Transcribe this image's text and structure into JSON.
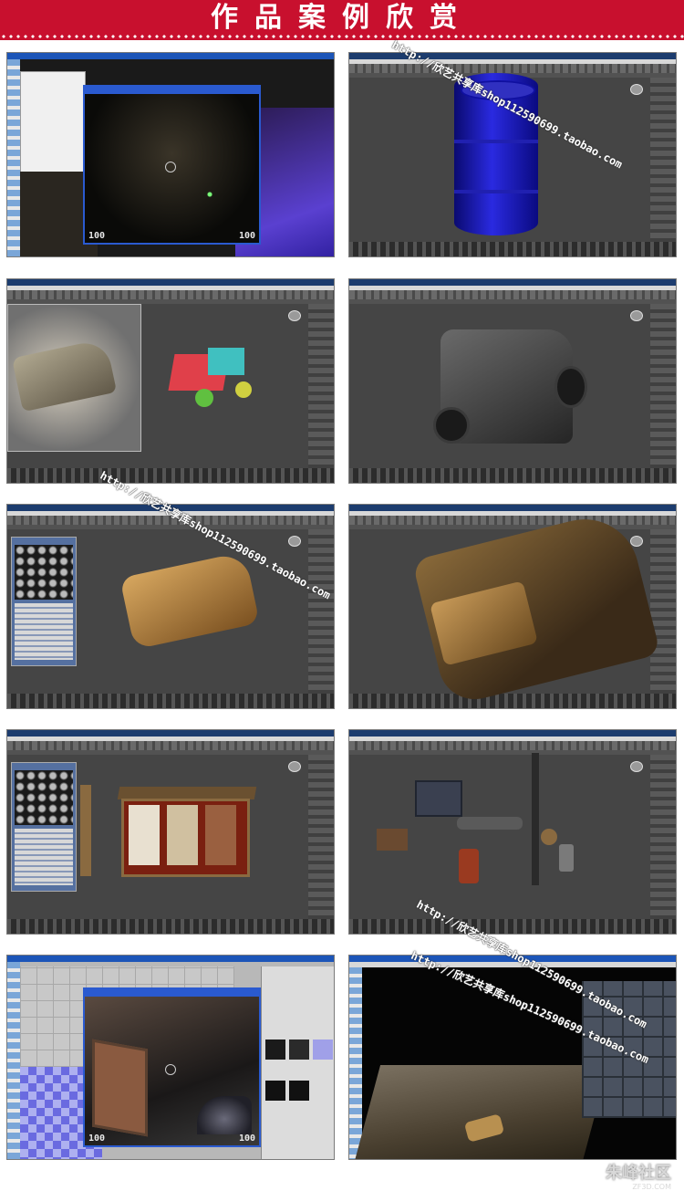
{
  "banner": {
    "title": "作品案例欣赏",
    "background": "#c8102e",
    "text_color": "#ffffff"
  },
  "screenshots": [
    {
      "label": "Unreal editor game preview with 3ds Max window",
      "hud_left": "100",
      "hud_right": "100"
    },
    {
      "label": "3ds Max oil barrel model"
    },
    {
      "label": "3ds Max jeep block-out with reference"
    },
    {
      "label": "3ds Max jeep high-poly model"
    },
    {
      "label": "3ds Max textured jeep with material editor"
    },
    {
      "label": "3ds Max textured jeep close-up"
    },
    {
      "label": "3ds Max bus shelter model with material editor"
    },
    {
      "label": "3ds Max props set"
    },
    {
      "label": "Unreal editor game preview bus shelter",
      "hud_left": "100",
      "hud_right": "100"
    },
    {
      "label": "3ds Max assembled scene"
    }
  ],
  "watermarks": [
    {
      "text": "http://欣艺共享库shop112590699.taobao.com"
    },
    {
      "text": "http://欣艺共享库shop112590699.taobao.com"
    },
    {
      "text": "http://欣艺共享库shop112590699.taobao.com"
    },
    {
      "text": "http://欣艺共享库shop112590699.taobao.com"
    }
  ],
  "site_logo": {
    "text": "朱峰社区",
    "sub": "ZF3D.COM"
  }
}
